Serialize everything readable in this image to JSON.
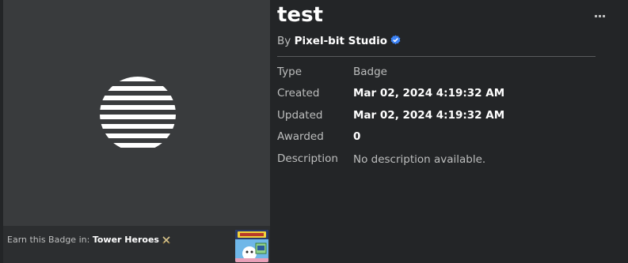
{
  "badge": {
    "title": "test",
    "by_prefix": "By",
    "creator": "Pixel-bit Studio",
    "image_icon": "striped-circle-badge-icon"
  },
  "details": {
    "type_label": "Type",
    "type_value": "Badge",
    "created_label": "Created",
    "created_value": "Mar 02, 2024 4:19:32 AM",
    "updated_label": "Updated",
    "updated_value": "Mar 02, 2024 4:19:32 AM",
    "awarded_label": "Awarded",
    "awarded_value": "0",
    "description_label": "Description",
    "description_value": "No description available."
  },
  "earn": {
    "prefix": "Earn this Badge in:",
    "game_name": "Tower Heroes",
    "game_icon": "crossed-swords-icon",
    "thumb_icon": "tower-heroes-thumbnail"
  },
  "colors": {
    "background": "#232527",
    "panel": "#393b3d",
    "verified": "#3b82f6",
    "text_primary": "#ffffff",
    "text_secondary": "#bdbebe"
  }
}
